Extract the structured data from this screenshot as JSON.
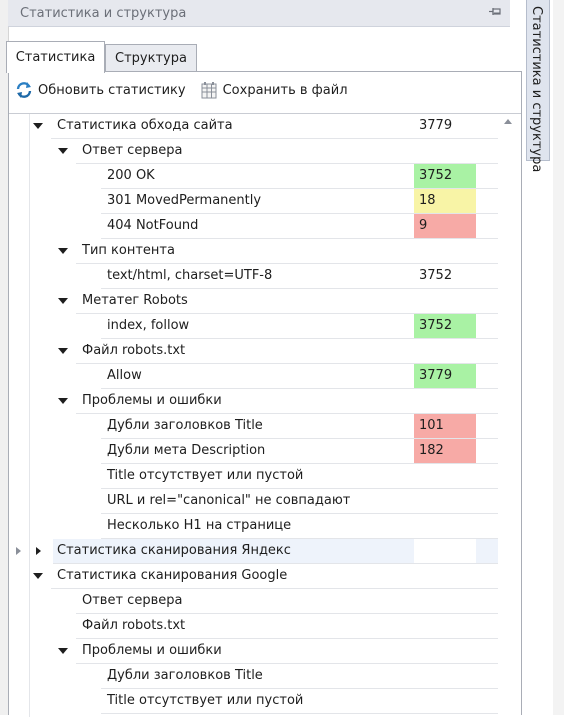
{
  "panel": {
    "title": "Статистика и структура"
  },
  "side_tab": {
    "label": "Статистика и структура"
  },
  "tabs": [
    {
      "label": "Статистика"
    },
    {
      "label": "Структура"
    }
  ],
  "toolbar": {
    "refresh_label": "Обновить статистику",
    "save_label": "Сохранить в файл"
  },
  "colors": {
    "green": "#a9f2a4",
    "yellow": "#f8f4a6",
    "red": "#f7aaa6",
    "highlight": "#eef3fb"
  },
  "tree": [
    {
      "label": "Статистика обхода сайта",
      "value": "3779",
      "level": 0,
      "expanded": true
    },
    {
      "label": "Ответ сервера",
      "value": "",
      "level": 1,
      "expanded": true
    },
    {
      "label": "200 OK",
      "value": "3752",
      "level": 2,
      "color": "green"
    },
    {
      "label": "301 MovedPermanently",
      "value": "18",
      "level": 2,
      "color": "yellow"
    },
    {
      "label": "404 NotFound",
      "value": "9",
      "level": 2,
      "color": "red"
    },
    {
      "label": "Тип контента",
      "value": "",
      "level": 1,
      "expanded": true
    },
    {
      "label": "text/html, charset=UTF-8",
      "value": "3752",
      "level": 2
    },
    {
      "label": "Метатег Robots",
      "value": "",
      "level": 1,
      "expanded": true
    },
    {
      "label": "index, follow",
      "value": "3752",
      "level": 2,
      "color": "green"
    },
    {
      "label": "Файл robots.txt",
      "value": "",
      "level": 1,
      "expanded": true
    },
    {
      "label": "Allow",
      "value": "3779",
      "level": 2,
      "color": "green"
    },
    {
      "label": "Проблемы и ошибки",
      "value": "",
      "level": 1,
      "expanded": true
    },
    {
      "label": "Дубли заголовков Title",
      "value": "101",
      "level": 2,
      "color": "red"
    },
    {
      "label": "Дубли мета Description",
      "value": "182",
      "level": 2,
      "color": "red"
    },
    {
      "label": "Title отсутствует или пустой",
      "value": "",
      "level": 2
    },
    {
      "label": "URL и rel=\"canonical\" не совпадают",
      "value": "",
      "level": 2
    },
    {
      "label": "Несколько H1 на странице",
      "value": "",
      "level": 2
    },
    {
      "label": "Статистика сканирования Яндекс",
      "value": "",
      "level": 0,
      "expanded": false,
      "selected": true
    },
    {
      "label": "Статистика сканирования Google",
      "value": "",
      "level": 0,
      "expanded": true
    },
    {
      "label": "Ответ сервера",
      "value": "",
      "level": 1
    },
    {
      "label": "Файл robots.txt",
      "value": "",
      "level": 1
    },
    {
      "label": "Проблемы и ошибки",
      "value": "",
      "level": 1,
      "expanded": true
    },
    {
      "label": "Дубли заголовков Title",
      "value": "",
      "level": 2
    },
    {
      "label": "Title отсутствует или пустой",
      "value": "",
      "level": 2
    }
  ]
}
